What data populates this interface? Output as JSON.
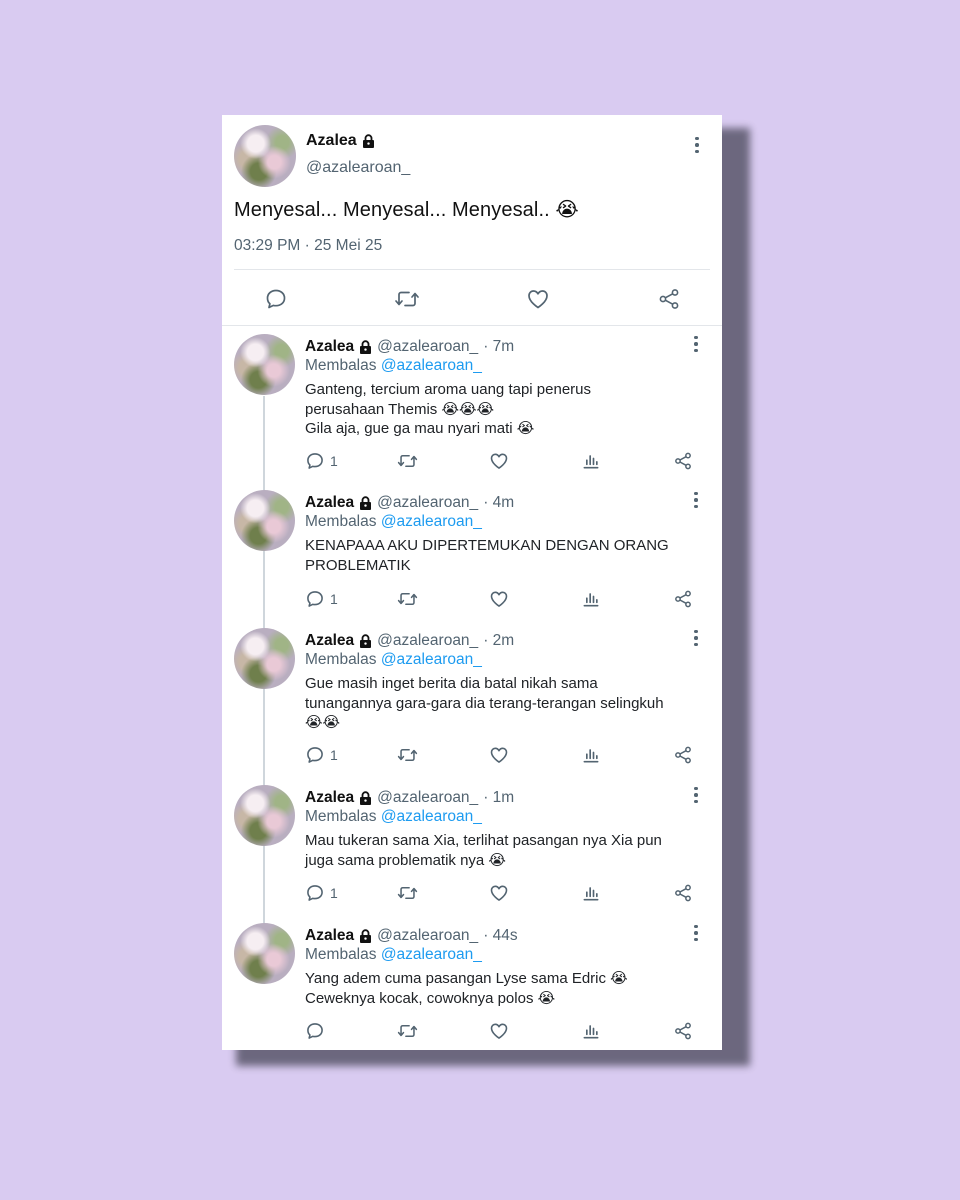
{
  "main_tweet": {
    "display_name": "Azalea",
    "handle": "@azalearoan_",
    "text": "Menyesal... Menyesal... Menyesal.. 😭",
    "timestamp": "03:29 PM · 25 Mei 25",
    "actions": [
      "reply-icon",
      "retweet-icon",
      "like-icon",
      "share-icon"
    ]
  },
  "replies": [
    {
      "display_name": "Azalea",
      "handle": "@azalearoan_",
      "time": "· 7m",
      "replying_prefix": "Membalas",
      "replying_to": "@azalearoan_",
      "lines": [
        "Ganteng, tercium aroma uang tapi penerus",
        "perusahaan Themis 😭😭😭",
        "Gila aja, gue ga mau nyari mati 😭"
      ],
      "reply_count": "1"
    },
    {
      "display_name": "Azalea",
      "handle": "@azalearoan_",
      "time": "· 4m",
      "replying_prefix": "Membalas",
      "replying_to": "@azalearoan_",
      "lines": [
        "KENAPAAA AKU DIPERTEMUKAN DENGAN ORANG",
        "PROBLEMATIK"
      ],
      "reply_count": "1"
    },
    {
      "display_name": "Azalea",
      "handle": "@azalearoan_",
      "time": "· 2m",
      "replying_prefix": "Membalas",
      "replying_to": "@azalearoan_",
      "lines": [
        "Gue masih inget berita dia batal nikah sama",
        "tunangannya gara-gara dia terang-terangan selingkuh",
        "😭😭"
      ],
      "reply_count": "1"
    },
    {
      "display_name": "Azalea",
      "handle": "@azalearoan_",
      "time": "· 1m",
      "replying_prefix": "Membalas",
      "replying_to": "@azalearoan_",
      "lines": [
        "Mau tukeran sama Xia, terlihat pasangan nya Xia pun",
        "juga sama problematik nya 😭"
      ],
      "reply_count": "1"
    },
    {
      "display_name": "Azalea",
      "handle": "@azalearoan_",
      "time": "· 44s",
      "replying_prefix": "Membalas",
      "replying_to": "@azalearoan_",
      "lines": [
        "Yang adem cuma pasangan Lyse sama Edric 😭",
        "Ceweknya kocak, cowoknya polos 😭"
      ],
      "reply_count": ""
    }
  ],
  "colors": {
    "background": "#d9cbf1",
    "card": "#ffffff",
    "muted_text": "#536471",
    "link": "#1d9bf0"
  }
}
